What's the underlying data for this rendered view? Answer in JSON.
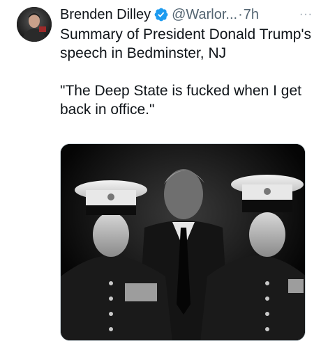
{
  "tweet": {
    "author_name": "Brenden Dilley",
    "handle": "@Warlor...",
    "separator": "·",
    "time": "7h",
    "more_label": "···",
    "text_line1": "Summary of President Donald Trump's speech in Bedminster, NJ",
    "text_quote": "\"The Deep State is fucked when I get back in office.\""
  },
  "colors": {
    "verified": "#1d9bf0",
    "secondary_text": "#536471",
    "primary_text": "#0f1419"
  },
  "icons": {
    "verified": "verified-badge-icon",
    "more": "more-icon"
  }
}
